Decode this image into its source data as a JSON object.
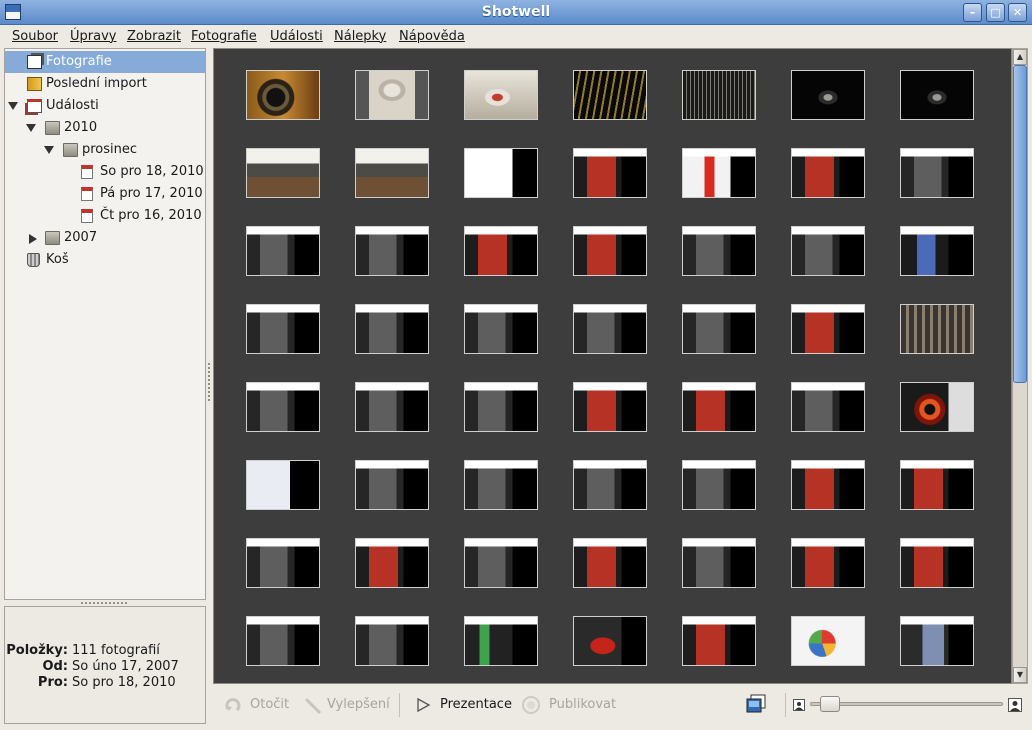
{
  "window": {
    "title": "Shotwell"
  },
  "menu": [
    "Soubor",
    "Úpravy",
    "Zobrazit",
    "Fotografie",
    "Události",
    "Nálepky",
    "Nápověda"
  ],
  "sidebar": {
    "items": [
      {
        "label": "Fotografie",
        "icon": "photos-icon",
        "selected": true
      },
      {
        "label": "Poslední import",
        "icon": "import-icon"
      },
      {
        "label": "Události",
        "icon": "events-icon",
        "expanded": true
      },
      {
        "label": "2010",
        "icon": "folder-icon",
        "expanded": true
      },
      {
        "label": "prosinec",
        "icon": "folder-icon",
        "expanded": true
      },
      {
        "label": "So pro 18, 2010",
        "icon": "calendar-icon"
      },
      {
        "label": "Pá pro 17, 2010",
        "icon": "calendar-icon"
      },
      {
        "label": "Čt pro 16, 2010",
        "icon": "calendar-icon"
      },
      {
        "label": "2007",
        "icon": "folder-icon",
        "expanded": false
      },
      {
        "label": "Koš",
        "icon": "trash-icon"
      }
    ]
  },
  "info": {
    "items_label": "Položky:",
    "items_value": "111 fotografií",
    "from_label": "Od:",
    "from_value": "So úno 17, 2007",
    "to_label": "Pro:",
    "to_value": "So pro 18, 2010"
  },
  "toolbar": {
    "rotate_label": "Otočit",
    "enhance_label": "Vylepšení",
    "slideshow_label": "Prezentace",
    "publish_label": "Publikovat"
  },
  "zoom": {
    "level": 0.05
  },
  "photos": {
    "visible_rows": 8,
    "thumbnails": [
      "camera",
      "lamp",
      "desk-object",
      "dark-gold",
      "dark-fabric",
      "dark-small",
      "dark-small",
      "classroom",
      "classroom",
      "screen",
      "screen-red",
      "screen-white-red",
      "screen-red",
      "screen-dark",
      "screen-dark",
      "screen-dark",
      "screen-red",
      "screen-red",
      "screen-dark",
      "screen-dark",
      "screen-blue",
      "screen-dark",
      "screen-dark",
      "screen-dark",
      "screen-dark",
      "screen-dark",
      "screen-red",
      "screen-gray",
      "screen-dark",
      "screen-dark",
      "screen-dark",
      "screen-red",
      "screen-red",
      "screen-dark",
      "eye",
      "screen-light",
      "screen-dark",
      "screen-dark",
      "screen-dark",
      "screen-dark",
      "screen-red",
      "screen-red",
      "screen-dark",
      "screen-red",
      "screen-dark",
      "screen-red",
      "screen-dark",
      "screen-red",
      "screen-red",
      "screen-dark",
      "screen-dark",
      "screen-green",
      "screen-red-big",
      "screen-red",
      "screen-pie",
      "screen-blue2"
    ]
  },
  "colors": {
    "selection": "#86abd9",
    "photo_bg": "#3d3d3d",
    "titlebar": "#6f9bd6"
  }
}
